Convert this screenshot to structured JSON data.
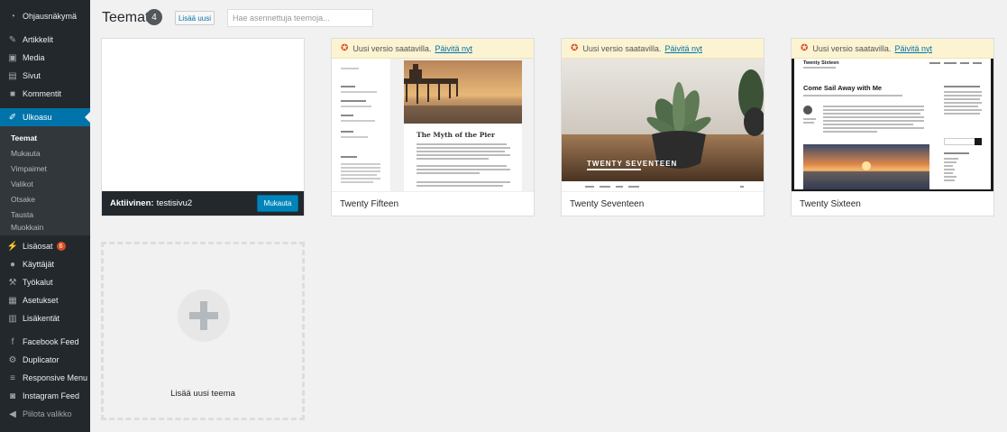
{
  "sidebar": {
    "items": [
      {
        "id": "dashboard",
        "label": "Ohjausnäkymä",
        "icon": "dashboard-icon"
      },
      {
        "id": "posts",
        "label": "Artikkelit",
        "icon": "pin-icon"
      },
      {
        "id": "media",
        "label": "Media",
        "icon": "media-icon"
      },
      {
        "id": "pages",
        "label": "Sivut",
        "icon": "page-icon"
      },
      {
        "id": "comments",
        "label": "Kommentit",
        "icon": "comment-icon"
      },
      {
        "id": "appearance",
        "label": "Ulkoasu",
        "icon": "brush-icon"
      },
      {
        "id": "plugins",
        "label": "Lisäosat",
        "icon": "plugin-icon",
        "badge": "6"
      },
      {
        "id": "users",
        "label": "Käyttäjät",
        "icon": "user-icon"
      },
      {
        "id": "tools",
        "label": "Työkalut",
        "icon": "wrench-icon"
      },
      {
        "id": "settings",
        "label": "Asetukset",
        "icon": "settings-icon"
      },
      {
        "id": "fields",
        "label": "Lisäkentät",
        "icon": "fields-icon"
      },
      {
        "id": "facebook",
        "label": "Facebook Feed",
        "icon": "facebook-icon"
      },
      {
        "id": "duplicator",
        "label": "Duplicator",
        "icon": "duplicator-icon"
      },
      {
        "id": "responsive",
        "label": "Responsive Menu",
        "icon": "menu-icon"
      },
      {
        "id": "instagram",
        "label": "Instagram Feed",
        "icon": "camera-icon"
      },
      {
        "id": "collapse",
        "label": "Piilota valikko",
        "icon": "collapse-icon"
      }
    ],
    "submenu": [
      "Teemat",
      "Mukauta",
      "Vimpaimet",
      "Valikot",
      "Otsake",
      "Tausta",
      "Muokkain"
    ]
  },
  "header": {
    "title": "Teemat",
    "count": "4",
    "add_new": "Lisää uusi",
    "search_placeholder": "Hae asennettuja teemoja..."
  },
  "active_theme": {
    "label": "Aktiivinen:",
    "name": "testisivu2",
    "customize": "Mukauta"
  },
  "themes": [
    {
      "name": "Twenty Fifteen",
      "update_text": "Uusi versio saatavilla.",
      "update_link": "Päivitä nyt",
      "preview_title": "The Myth of the Pier"
    },
    {
      "name": "Twenty Seventeen",
      "update_text": "Uusi versio saatavilla.",
      "update_link": "Päivitä nyt",
      "preview_title": "TWENTY SEVENTEEN"
    },
    {
      "name": "Twenty Sixteen",
      "update_text": "Uusi versio saatavilla.",
      "update_link": "Päivitä nyt",
      "preview_site": "Twenty Sixteen",
      "preview_title": "Come Sail Away with Me"
    }
  ],
  "add_new_theme": {
    "label": "Lisää uusi teema"
  },
  "colors": {
    "sidebar": "#23282d",
    "accent": "#0073aa",
    "badge": "#d54e21",
    "notice": "#fcf3d2"
  }
}
